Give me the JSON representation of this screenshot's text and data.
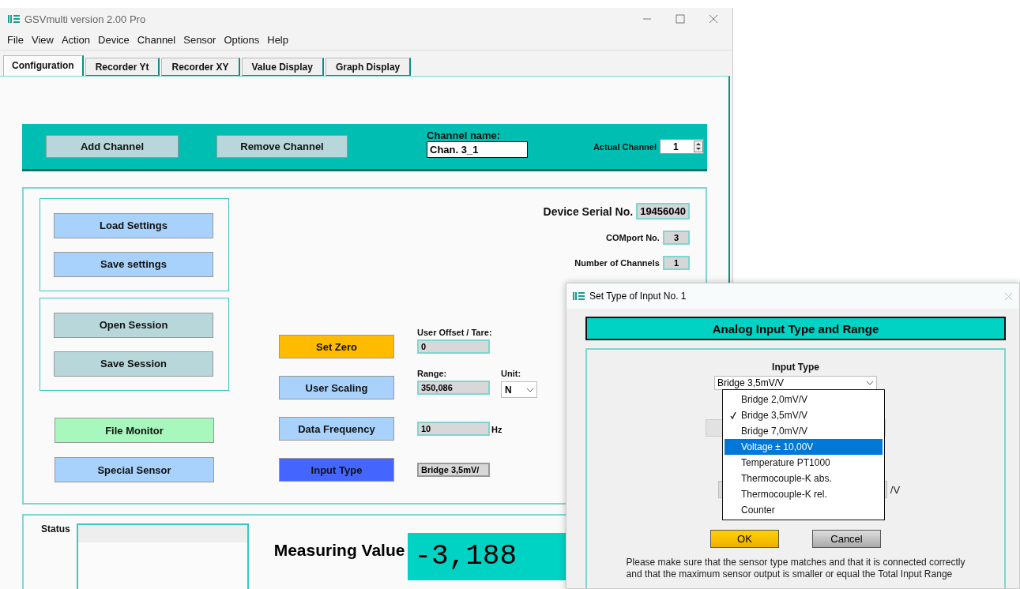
{
  "window": {
    "title": "GSVmulti version 2.00 Pro"
  },
  "menu": [
    "File",
    "View",
    "Action",
    "Device",
    "Channel",
    "Sensor",
    "Options",
    "Help"
  ],
  "tabs": [
    {
      "label": "Configuration",
      "selected": true
    },
    {
      "label": "Recorder Yt",
      "selected": false
    },
    {
      "label": "Recorder XY",
      "selected": false
    },
    {
      "label": "Value Display",
      "selected": false
    },
    {
      "label": "Graph Display",
      "selected": false
    }
  ],
  "channel_bar": {
    "add_button": "Add Channel",
    "remove_button": "Remove Channel",
    "name_label": "Channel name:",
    "name_value": "Chan. 3_1",
    "actual_label": "Actual Channel",
    "actual_value": "1"
  },
  "groups": [
    {
      "buttons": [
        {
          "label": "Load Settings",
          "color": "#a8d2fc"
        },
        {
          "label": "Save settings",
          "color": "#a8d2fc"
        }
      ]
    },
    {
      "buttons": [
        {
          "label": "Open Session",
          "color": "#b8d7db"
        },
        {
          "label": "Save Session",
          "color": "#b8d7db"
        }
      ]
    }
  ],
  "loose_buttons": [
    {
      "label": "File Monitor",
      "color": "#a8f7bd"
    },
    {
      "label": "Special Sensor",
      "color": "#a8d2fc"
    }
  ],
  "device_info": [
    {
      "label": "Device Serial No.",
      "value": "19456040",
      "kind": "large"
    },
    {
      "label": "COMport No.",
      "value": "3",
      "kind": "small"
    },
    {
      "label": "Number of Channels",
      "value": "1",
      "kind": "small"
    }
  ],
  "controls": [
    {
      "button": {
        "label": "Set Zero",
        "color": "#ffbb00"
      },
      "field_label": "User Offset / Tare:",
      "field_value": "0",
      "kind": "input"
    },
    {
      "button": {
        "label": "User Scaling",
        "color": "#a8d2fc"
      },
      "field_label": "Range:",
      "field_value": "350,086",
      "kind": "input",
      "unit": {
        "label": "Unit:",
        "value": "N"
      }
    },
    {
      "button": {
        "label": "Data Frequency",
        "color": "#a8d2fc"
      },
      "field_value": "10",
      "kind": "input",
      "suffix": "Hz"
    },
    {
      "button": {
        "label": "Input Type",
        "color": "#4466ff"
      },
      "field_value": "Bridge 3,5mV/",
      "kind": "display"
    }
  ],
  "status": {
    "label": "Status",
    "measuring_label": "Measuring Value",
    "measuring_value": "-3,188"
  },
  "dialog": {
    "title": "Set Type of Input No. 1",
    "header": "Analog Input Type and Range",
    "input_type_label": "Input Type",
    "select_value": "Bridge 3,5mV/V",
    "options": [
      {
        "label": "Bridge 2,0mV/V",
        "checked": false,
        "selected": false
      },
      {
        "label": "Bridge 3,5mV/V",
        "checked": true,
        "selected": false
      },
      {
        "label": "Bridge 7,0mV/V",
        "checked": false,
        "selected": false
      },
      {
        "label": "Voltage ± 10,00V",
        "checked": false,
        "selected": true
      },
      {
        "label": "Temperature PT1000",
        "checked": false,
        "selected": false
      },
      {
        "label": "Thermocouple-K abs.",
        "checked": false,
        "selected": false
      },
      {
        "label": "Thermocouple-K rel.",
        "checked": false,
        "selected": false
      },
      {
        "label": "Counter",
        "checked": false,
        "selected": false
      }
    ],
    "hidden_unit": "/V",
    "ok": "OK",
    "cancel": "Cancel",
    "note": [
      "Please make sure that the sensor type matches and that it is connected correctly",
      "and that the maximum sensor output is smaller or equal the Total Input Range"
    ]
  }
}
